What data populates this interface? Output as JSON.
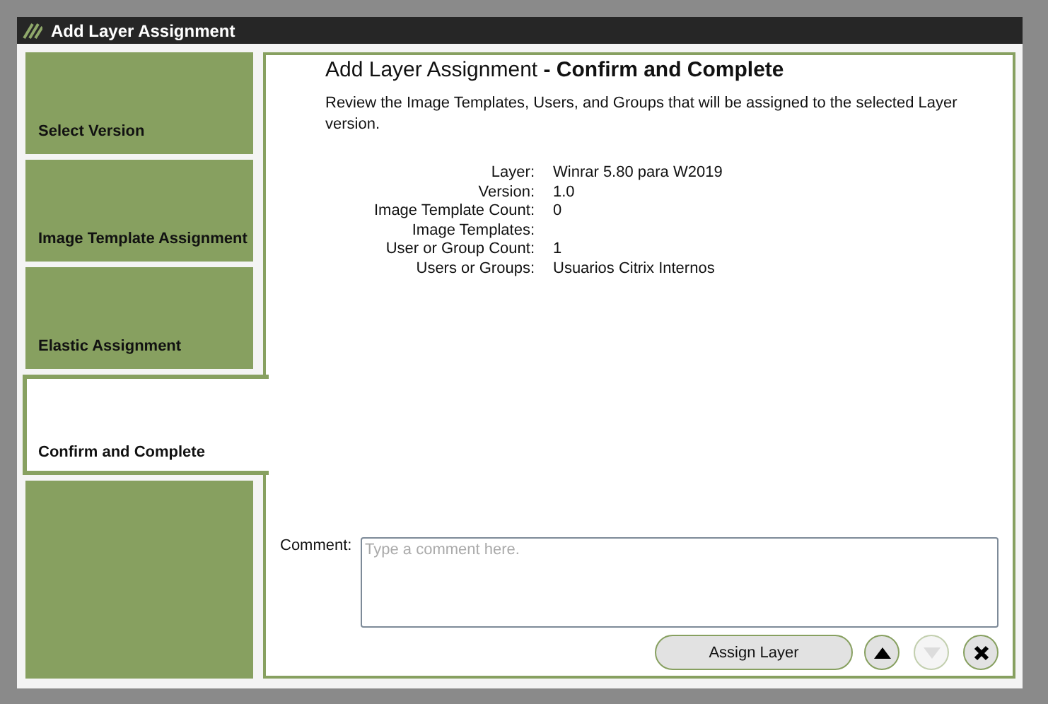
{
  "window": {
    "title": "Add Layer Assignment"
  },
  "steps": [
    {
      "label": "Select Version",
      "selected": false
    },
    {
      "label": "Image Template Assignment",
      "selected": false
    },
    {
      "label": "Elastic Assignment",
      "selected": false
    },
    {
      "label": "Confirm and Complete",
      "selected": true
    }
  ],
  "header": {
    "title": "Add Layer Assignment",
    "subtitle": "- Confirm and Complete",
    "description": "Review the Image Templates, Users, and Groups that will be assigned to the selected Layer version."
  },
  "summary": [
    {
      "label": "Layer:",
      "value": "Winrar 5.80 para W2019"
    },
    {
      "label": "Version:",
      "value": "1.0"
    },
    {
      "label": "Image Template Count:",
      "value": "0"
    },
    {
      "label": "Image Templates:"
    },
    {
      "label": "User or Group Count:",
      "value": "1"
    },
    {
      "label": "Users or Groups:",
      "value": "Usuarios Citrix Internos"
    }
  ],
  "comment": {
    "label": "Comment:",
    "placeholder": "Type a comment here."
  },
  "actions": {
    "primary": "Assign Layer",
    "up_disabled": false,
    "down_disabled": true
  }
}
